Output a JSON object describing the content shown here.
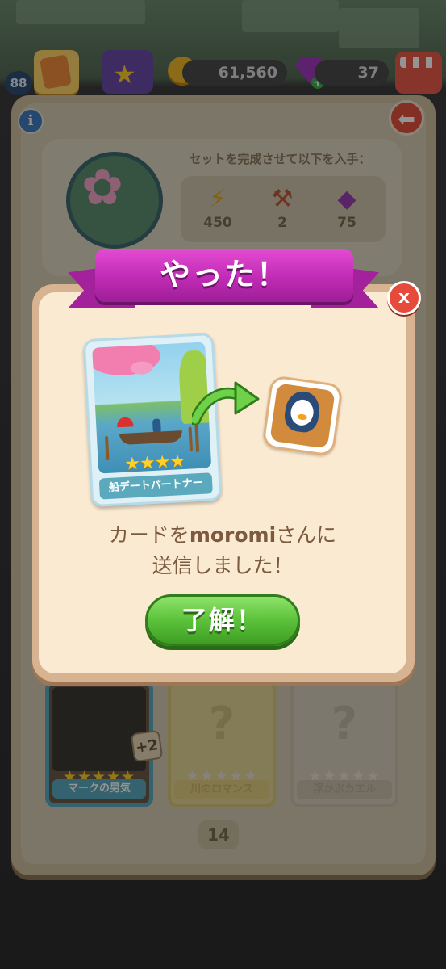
{
  "hud": {
    "level": "88",
    "coins": "61,560",
    "gems": "37"
  },
  "album": {
    "set_title": "セットを完成させて以下を入手：",
    "rewards": [
      {
        "icon": "lightning-icon",
        "value": "450"
      },
      {
        "icon": "toolbox-icon",
        "value": "2"
      },
      {
        "icon": "gem-icon",
        "value": "75"
      }
    ],
    "cards": [
      {
        "name": "マークの男気",
        "stars": "★★★★★",
        "owned": true,
        "duplicates": "+2"
      },
      {
        "name": "川のロマンス",
        "stars": "★★★★★",
        "owned": false,
        "placeholder": "?"
      },
      {
        "name": "浮かぶカエル",
        "stars": "★★★★★",
        "owned": false,
        "placeholder": "?"
      }
    ],
    "page_number": "14"
  },
  "modal": {
    "title": "やった！",
    "close_label": "x",
    "card": {
      "name": "船デートパートナー",
      "stars": "★★★★"
    },
    "message_prefix": "カードを",
    "recipient": "moromi",
    "message_suffix": "さんに",
    "message_line2": "送信しました！",
    "ok_label": "了解！"
  },
  "colors": {
    "ribbon": "#c02bb5",
    "ok_button": "#5cc23a",
    "close_button": "#e64a3a",
    "card_label": "#5aa9bd",
    "message_text": "#7b5a3e"
  }
}
